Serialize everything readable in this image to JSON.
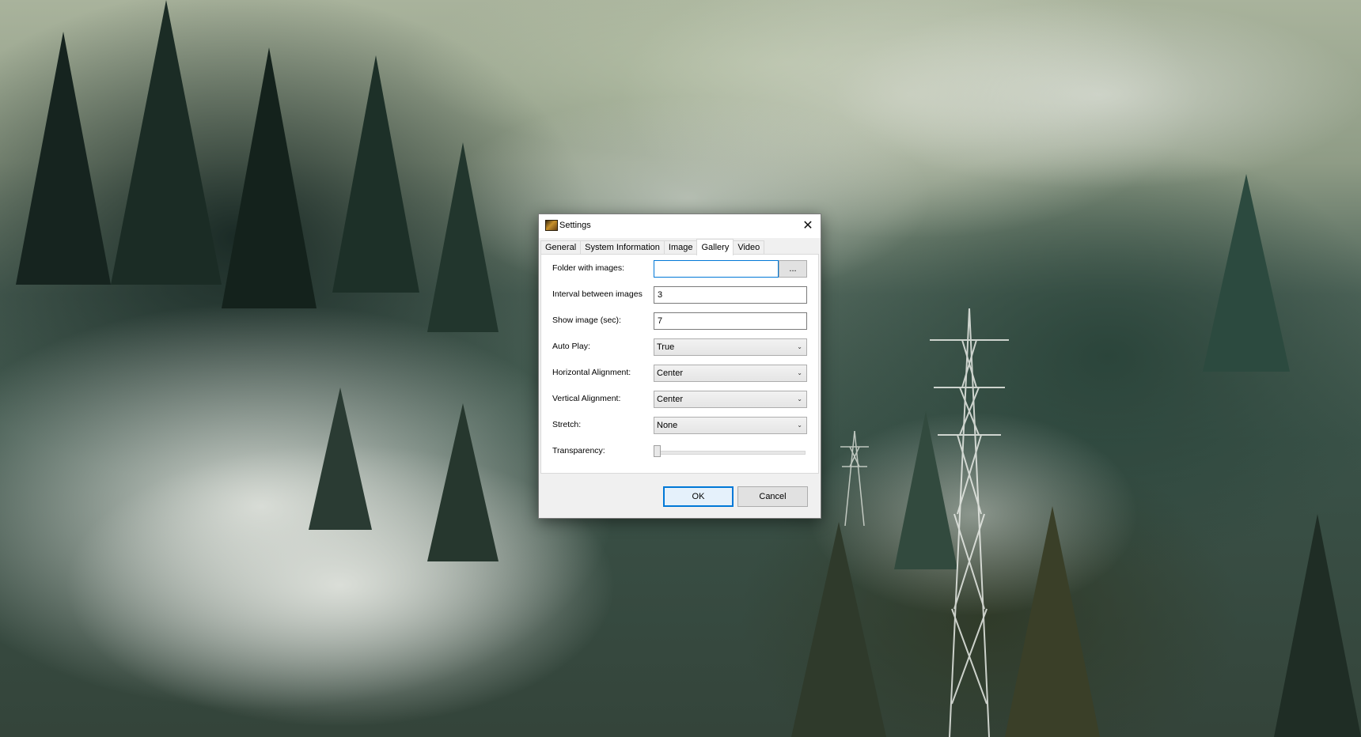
{
  "window": {
    "title": "Settings",
    "app_icon": "photo-app-icon",
    "close_glyph": "✕"
  },
  "tabs": [
    {
      "label": "General",
      "active": false
    },
    {
      "label": "System Information",
      "active": false
    },
    {
      "label": "Image",
      "active": false
    },
    {
      "label": "Gallery",
      "active": true
    },
    {
      "label": "Video",
      "active": false
    }
  ],
  "gallery": {
    "folder": {
      "label": "Folder with images:",
      "value": "",
      "browse_label": "..."
    },
    "interval": {
      "label": "Interval between images",
      "value": "3"
    },
    "show_image": {
      "label": "Show image (sec):",
      "value": "7"
    },
    "auto_play": {
      "label": "Auto Play:",
      "value": "True"
    },
    "horizontal_alignment": {
      "label": "Horizontal Alignment:",
      "value": "Center"
    },
    "vertical_alignment": {
      "label": "Vertical Alignment:",
      "value": "Center"
    },
    "stretch": {
      "label": "Stretch:",
      "value": "None"
    },
    "transparency": {
      "label": "Transparency:",
      "value": 0
    }
  },
  "footer": {
    "ok_label": "OK",
    "cancel_label": "Cancel"
  },
  "icons": {
    "dropdown": "⌄"
  },
  "colors": {
    "accent": "#0078d7",
    "dialog_bg": "#f0f0f0",
    "panel_bg": "#ffffff"
  }
}
